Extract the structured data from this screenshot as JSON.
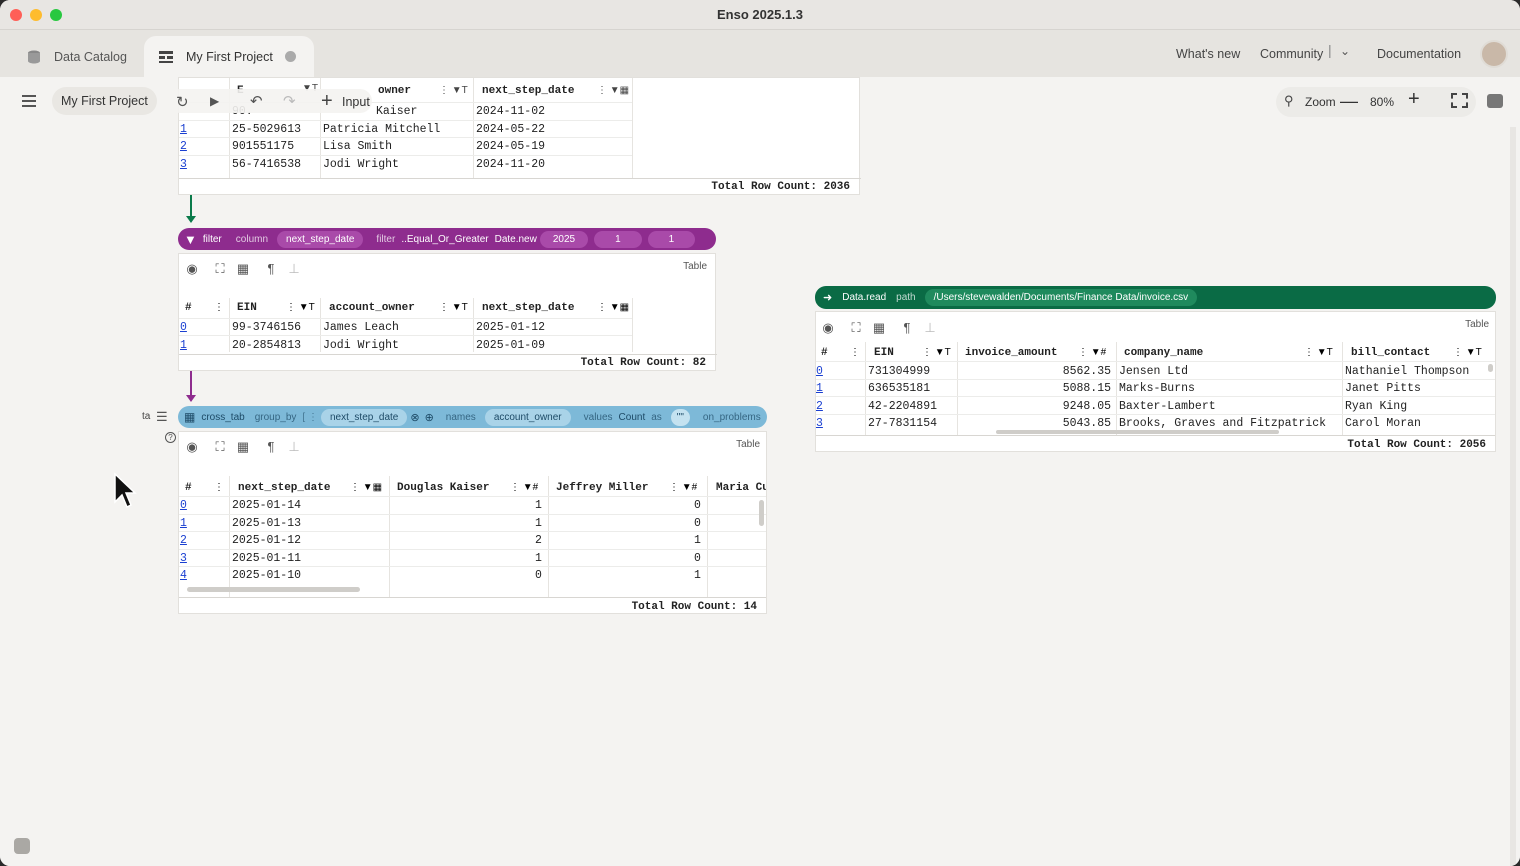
{
  "app": {
    "title": "Enso 2025.1.3"
  },
  "tabs": [
    {
      "label": "Data Catalog"
    },
    {
      "label": "My First Project"
    }
  ],
  "top_links": {
    "whats_new": "What's new",
    "community": "Community",
    "documentation": "Documentation"
  },
  "toolbar": {
    "breadcrumb": "My First Project",
    "input_label": "Input",
    "zoom_label": "Zoom",
    "zoom_value": "80%"
  },
  "node1": {
    "headers": [
      "E",
      "owner",
      "next_step_date"
    ],
    "rows": [
      [
        "",
        "90.",
        "Kaiser",
        "2024-11-02"
      ],
      [
        "1",
        "25-5029613",
        "Patricia Mitchell",
        "2024-05-22"
      ],
      [
        "2",
        "901551175",
        "Lisa Smith",
        "2024-05-19"
      ],
      [
        "3",
        "56-7416538",
        "Jodi Wright",
        "2024-11-20"
      ]
    ],
    "total": "Total Row Count: 2036"
  },
  "filter": {
    "name": "filter",
    "column_lbl": "column",
    "column_val": "next_step_date",
    "filter_lbl": "filter",
    "filter_val": "..Equal_Or_Greater",
    "date_lbl": "Date.new",
    "year": "2025",
    "month": "1",
    "day": "1"
  },
  "node2": {
    "table_label": "Table",
    "headers": [
      "#",
      "EIN",
      "account_owner",
      "next_step_date"
    ],
    "rows": [
      [
        "0",
        "99-3746156",
        "James Leach",
        "2025-01-12"
      ],
      [
        "1",
        "20-2854813",
        "Jodi Wright",
        "2025-01-09"
      ]
    ],
    "total": "Total Row Count: 82"
  },
  "crosstab": {
    "side_lbl": "ta",
    "name": "cross_tab",
    "group_lbl": "group_by",
    "group_val": "next_step_date",
    "names_lbl": "names",
    "names_val": "account_owner",
    "values_lbl": "values",
    "count": "Count",
    "as_lbl": "as",
    "quote": "\"\"",
    "problems_lbl": "on_problems"
  },
  "node3": {
    "table_label": "Table",
    "headers": [
      "#",
      "next_step_date",
      "Douglas Kaiser",
      "Jeffrey Miller",
      "Maria Cu"
    ],
    "rows": [
      [
        "0",
        "2025-01-14",
        "1",
        "0"
      ],
      [
        "1",
        "2025-01-13",
        "1",
        "0"
      ],
      [
        "2",
        "2025-01-12",
        "2",
        "1"
      ],
      [
        "3",
        "2025-01-11",
        "1",
        "0"
      ],
      [
        "4",
        "2025-01-10",
        "0",
        "1"
      ]
    ],
    "total": "Total Row Count: 14"
  },
  "dataread": {
    "name": "Data.read",
    "path_lbl": "path",
    "path_val": "/Users/stevewalden/Documents/Finance Data/invoice.csv"
  },
  "node4": {
    "table_label": "Table",
    "headers": [
      "#",
      "EIN",
      "invoice_amount",
      "company_name",
      "bill_contact"
    ],
    "rows": [
      [
        "0",
        "731304999",
        "8562.35",
        "Jensen Ltd",
        "Nathaniel Thompson"
      ],
      [
        "1",
        "636535181",
        "5088.15",
        "Marks-Burns",
        "Janet Pitts"
      ],
      [
        "2",
        "42-2204891",
        "9248.05",
        "Baxter-Lambert",
        "Ryan King"
      ],
      [
        "3",
        "27-7831154",
        "5043.85",
        "Brooks, Graves and Fitzpatrick",
        "Carol Moran"
      ]
    ],
    "total": "Total Row Count: 2056"
  },
  "colors": {
    "filter": "#8e2c8e",
    "crosstab": "#7db9d8",
    "dataread": "#0a6b45",
    "edge_green": "#0a7a4a",
    "edge_purple": "#8e2c8e"
  }
}
